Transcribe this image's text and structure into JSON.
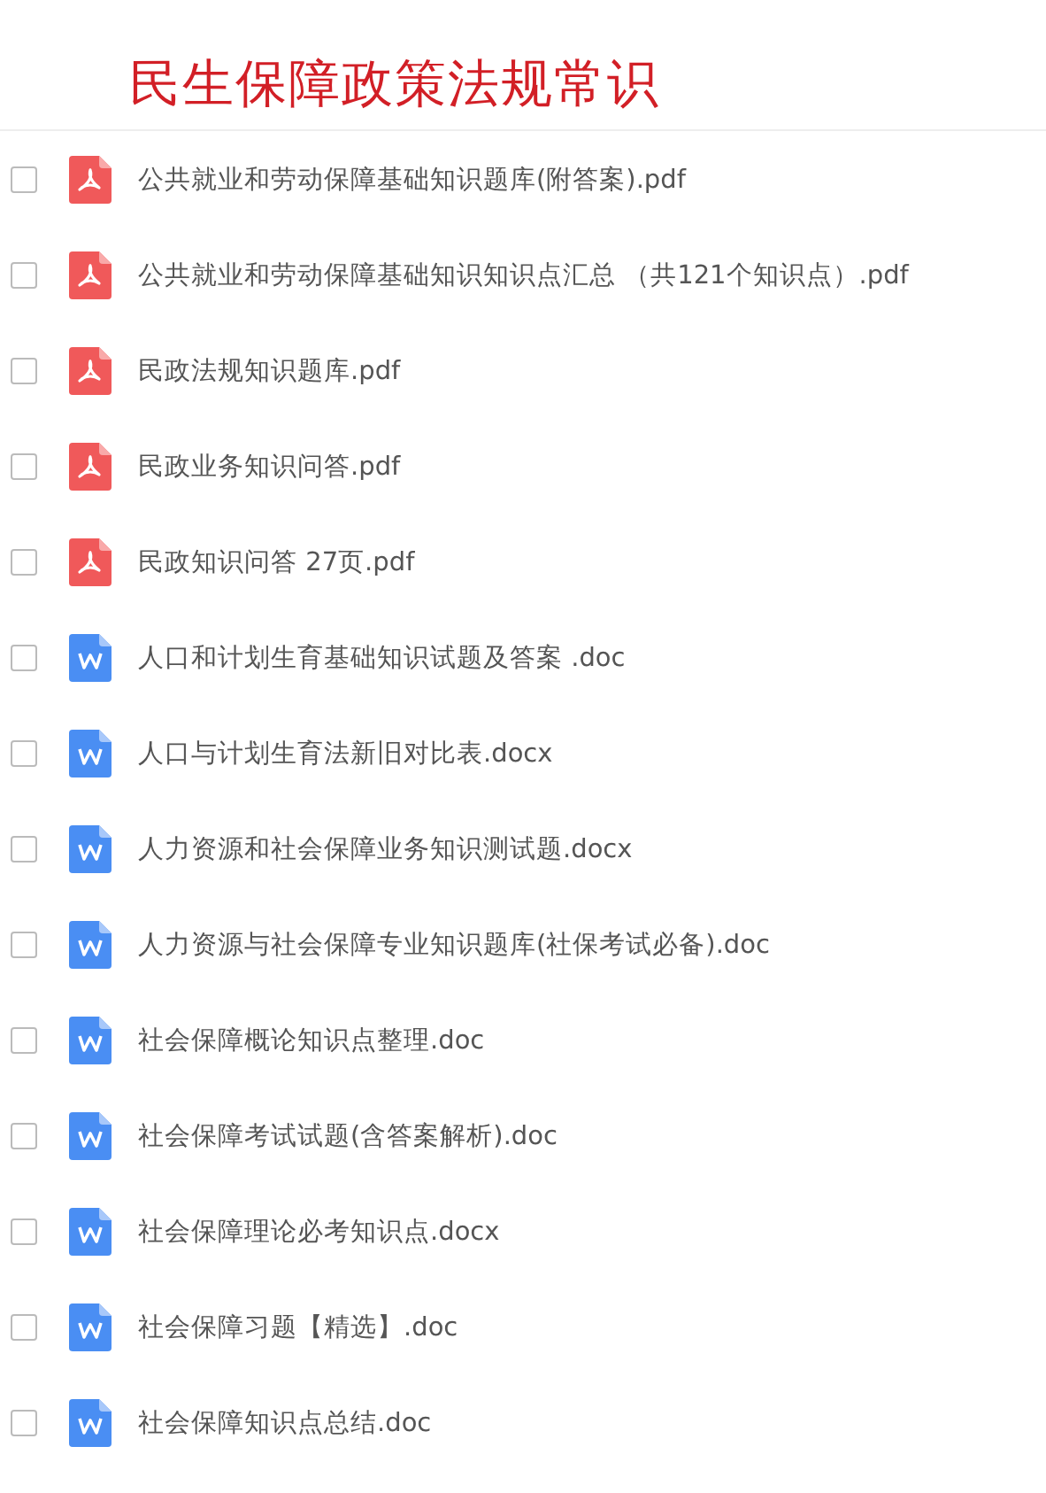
{
  "title": "民生保障政策法规常识",
  "files": [
    {
      "name": "公共就业和劳动保障基础知识题库(附答案).pdf",
      "kind": "pdf",
      "checked": false
    },
    {
      "name": "公共就业和劳动保障基础知识知识点汇总 （共121个知识点）.pdf",
      "kind": "pdf",
      "checked": false
    },
    {
      "name": "民政法规知识题库.pdf",
      "kind": "pdf",
      "checked": false
    },
    {
      "name": "民政业务知识问答.pdf",
      "kind": "pdf",
      "checked": false
    },
    {
      "name": "民政知识问答 27页.pdf",
      "kind": "pdf",
      "checked": false
    },
    {
      "name": "人口和计划生育基础知识试题及答案 .doc",
      "kind": "word",
      "checked": false
    },
    {
      "name": "人口与计划生育法新旧对比表.docx",
      "kind": "word",
      "checked": false
    },
    {
      "name": "人力资源和社会保障业务知识测试题.docx",
      "kind": "word",
      "checked": false
    },
    {
      "name": "人力资源与社会保障专业知识题库(社保考试必备).doc",
      "kind": "word",
      "checked": false
    },
    {
      "name": "社会保障概论知识点整理.doc",
      "kind": "word",
      "checked": false
    },
    {
      "name": "社会保障考试试题(含答案解析).doc",
      "kind": "word",
      "checked": false
    },
    {
      "name": "社会保障理论必考知识点.docx",
      "kind": "word",
      "checked": false
    },
    {
      "name": "社会保障习题【精选】.doc",
      "kind": "word",
      "checked": false
    },
    {
      "name": "社会保障知识点总结.doc",
      "kind": "word",
      "checked": false
    }
  ]
}
